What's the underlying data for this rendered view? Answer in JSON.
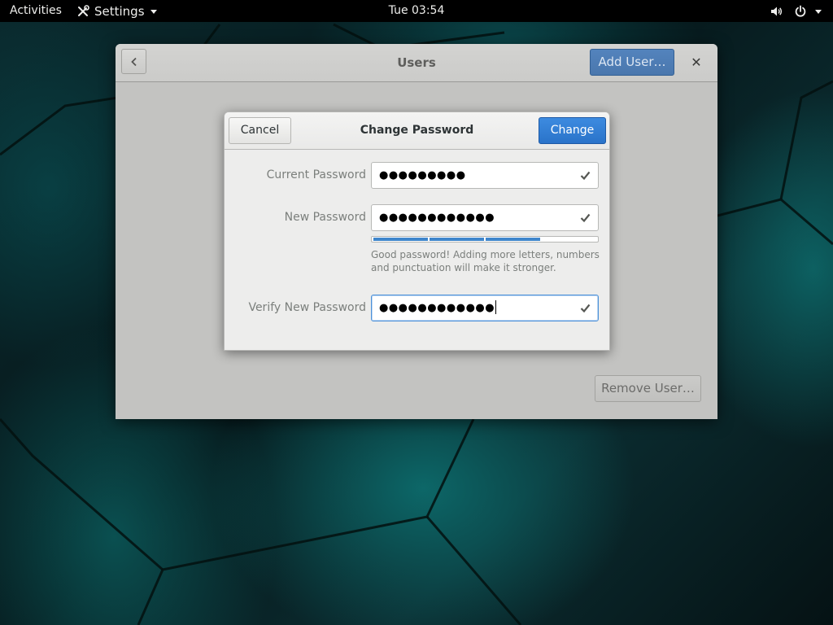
{
  "topbar": {
    "activities": "Activities",
    "app_menu": "Settings",
    "clock": "Tue 03:54"
  },
  "window": {
    "title": "Users",
    "add_user": "Add User…",
    "close_glyph": "✕",
    "remove_user": "Remove User…"
  },
  "dialog": {
    "title": "Change Password",
    "cancel": "Cancel",
    "change": "Change",
    "current_label": "Current Password",
    "current_value": "●●●●●●●●●",
    "new_label": "New Password",
    "new_value": "●●●●●●●●●●●●",
    "strength_level": 0.75,
    "strength_hint": "Good password! Adding more letters, numbers and punctuation will make it stronger.",
    "verify_label": "Verify New Password",
    "verify_value": "●●●●●●●●●●●●"
  },
  "icons": {
    "back": "chevron-left-icon",
    "settings": "tools-icon",
    "volume": "volume-icon",
    "power": "power-icon",
    "check": "check-icon"
  },
  "colors": {
    "accent": "#3584e4",
    "strength_fill": "#3f86cc",
    "topbar": "#000000"
  }
}
